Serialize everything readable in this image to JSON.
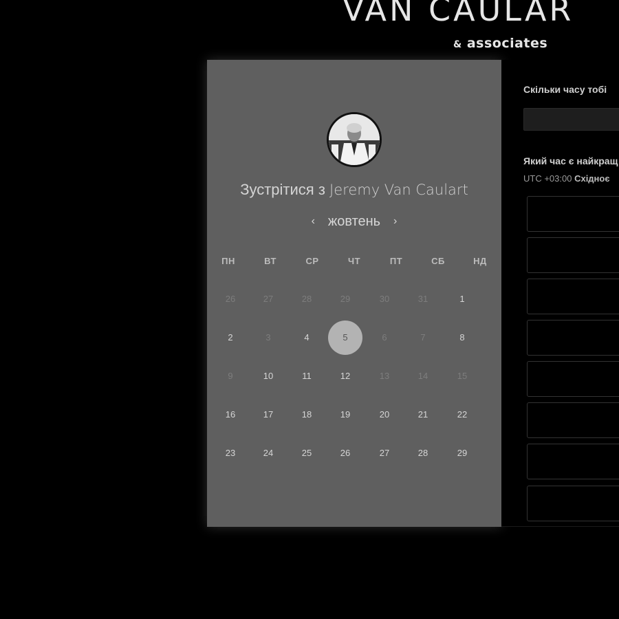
{
  "brand": {
    "title": "VAN CAULAR",
    "subtitle_amp": "&",
    "subtitle": "associates"
  },
  "booking": {
    "avatar_alt": "Jeremy Van Caulart photo",
    "meet_prefix": "Зустрітися з",
    "host_name": "Jeremy Van Caulart",
    "prev_arrow": "‹",
    "month": "жовтень",
    "next_arrow": "›",
    "weekdays": [
      "ПН",
      "ВТ",
      "СР",
      "ЧТ",
      "ПТ",
      "СБ",
      "НД"
    ],
    "days": [
      {
        "label": "26",
        "available": false
      },
      {
        "label": "27",
        "available": false
      },
      {
        "label": "28",
        "available": false
      },
      {
        "label": "29",
        "available": false
      },
      {
        "label": "30",
        "available": false
      },
      {
        "label": "31",
        "available": false
      },
      {
        "label": "1",
        "available": true
      },
      {
        "label": "2",
        "available": true
      },
      {
        "label": "3",
        "available": false
      },
      {
        "label": "4",
        "available": true
      },
      {
        "label": "5",
        "available": true,
        "selected": true
      },
      {
        "label": "6",
        "available": false
      },
      {
        "label": "7",
        "available": false
      },
      {
        "label": "8",
        "available": true
      },
      {
        "label": "9",
        "available": false
      },
      {
        "label": "10",
        "available": true
      },
      {
        "label": "11",
        "available": true
      },
      {
        "label": "12",
        "available": true
      },
      {
        "label": "13",
        "available": false
      },
      {
        "label": "14",
        "available": false
      },
      {
        "label": "15",
        "available": false
      },
      {
        "label": "16",
        "available": true
      },
      {
        "label": "17",
        "available": true
      },
      {
        "label": "18",
        "available": true
      },
      {
        "label": "19",
        "available": true
      },
      {
        "label": "20",
        "available": true
      },
      {
        "label": "21",
        "available": true
      },
      {
        "label": "22",
        "available": true
      },
      {
        "label": "23",
        "available": true
      },
      {
        "label": "24",
        "available": true
      },
      {
        "label": "25",
        "available": true
      },
      {
        "label": "26",
        "available": true
      },
      {
        "label": "27",
        "available": true
      },
      {
        "label": "28",
        "available": true
      },
      {
        "label": "29",
        "available": true
      }
    ]
  },
  "details": {
    "duration_question": "Скільки часу тобі",
    "time_question": "Який час є найкращ",
    "timezone_offset": "UTC +03:00",
    "timezone_name": "Східноє"
  },
  "colors": {
    "panel": "#5f5f5f",
    "selected_day": "#b3b3b3",
    "background": "#000000"
  }
}
